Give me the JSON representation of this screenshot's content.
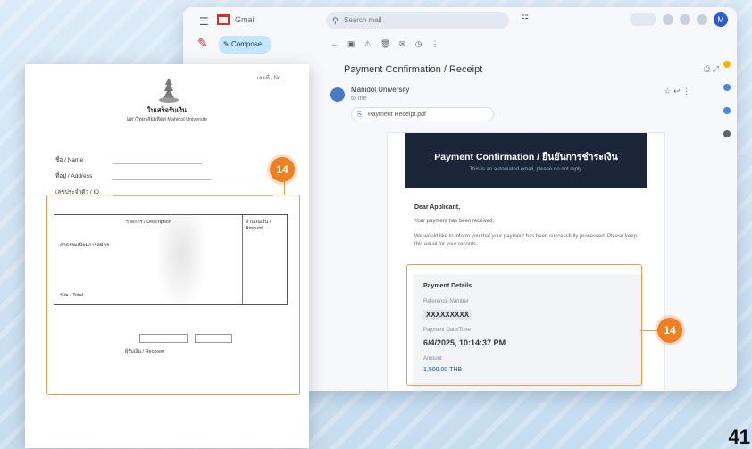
{
  "mail": {
    "search_placeholder": "Search mail",
    "compose_label": "Compose",
    "subject": "Payment Confirmation / Receipt",
    "sender_name": "Mahidol University",
    "sender_to": "to me",
    "attachment_name": "Payment Receipt.pdf",
    "banner_title": "Payment Confirmation / ยืนยันการชำระเงิน",
    "banner_subtitle": "This is an automated email, please do not reply.",
    "greeting": "Dear Applicant,",
    "line1": "Your payment has been received.",
    "line2": "We would like to inform you that your payment has been successfully processed. Please keep this email for your records.",
    "details_heading": "Payment Details",
    "details_label1": "Reference Number",
    "details_value1": "XXXXXXXXX",
    "details_label2": "Payment Date/Time",
    "details_value2": "6/4/2025, 10:14:37 PM",
    "details_label3": "Amount",
    "details_value3": "1,500.00 THB"
  },
  "document": {
    "title": "ใบเสร็จรับเงิน",
    "ref": "เลขที่ / No.",
    "subtitle": "มหาวิทยาลัยมหิดล Mahidol University",
    "row_labels": [
      "ชื่อ / Name",
      "ที่อยู่ / Address",
      "เลขประจำตัว / ID"
    ],
    "table_header_left": "รายการ / Description",
    "table_header_right": "จำนวนเงิน / Amount",
    "table_item": "ค่าธรรมเนียมการสมัคร",
    "total_label": "รวม / Total",
    "receiver_label": "ผู้รับเงิน / Receiver"
  },
  "markers": {
    "left": "14",
    "right": "14"
  },
  "page_number": "41",
  "colors": {
    "accent_orange": "#f07f22",
    "banner_navy": "#1b2739"
  }
}
